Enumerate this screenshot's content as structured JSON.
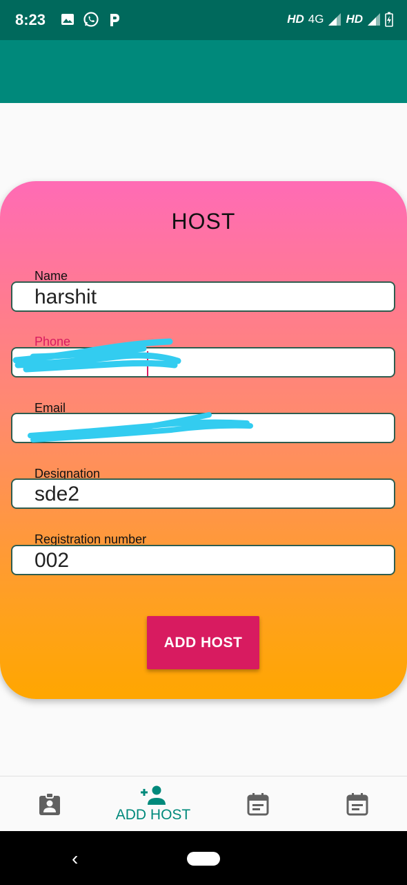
{
  "status_bar": {
    "time": "8:23",
    "network_left": "HD",
    "network_type": "4G",
    "network_right": "HD",
    "icons": [
      "image-icon",
      "whatsapp-icon",
      "p-icon",
      "signal-icon",
      "battery-icon"
    ]
  },
  "form": {
    "title": "HOST",
    "fields": [
      {
        "label": "Name",
        "value": "harshit"
      },
      {
        "label": "Phone",
        "value": ""
      },
      {
        "label": "Email",
        "value": ""
      },
      {
        "label": "Designation",
        "value": "sde2"
      },
      {
        "label": "Registration number",
        "value": "002"
      }
    ],
    "submit_label": "ADD HOST"
  },
  "bottom_nav": {
    "items": [
      {
        "icon": "badge-icon",
        "label": ""
      },
      {
        "icon": "person-add-icon",
        "label": "ADD HOST"
      },
      {
        "icon": "event-note-icon",
        "label": ""
      },
      {
        "icon": "event-note-icon",
        "label": ""
      }
    ]
  },
  "colors": {
    "status_bar": "#00695c",
    "app_bar": "#00897b",
    "accent": "#d81b60",
    "gradient_top": "#ff6bb5",
    "gradient_bottom": "#ffa600",
    "nav_active": "#00897b",
    "redaction": "#33ccf0"
  }
}
